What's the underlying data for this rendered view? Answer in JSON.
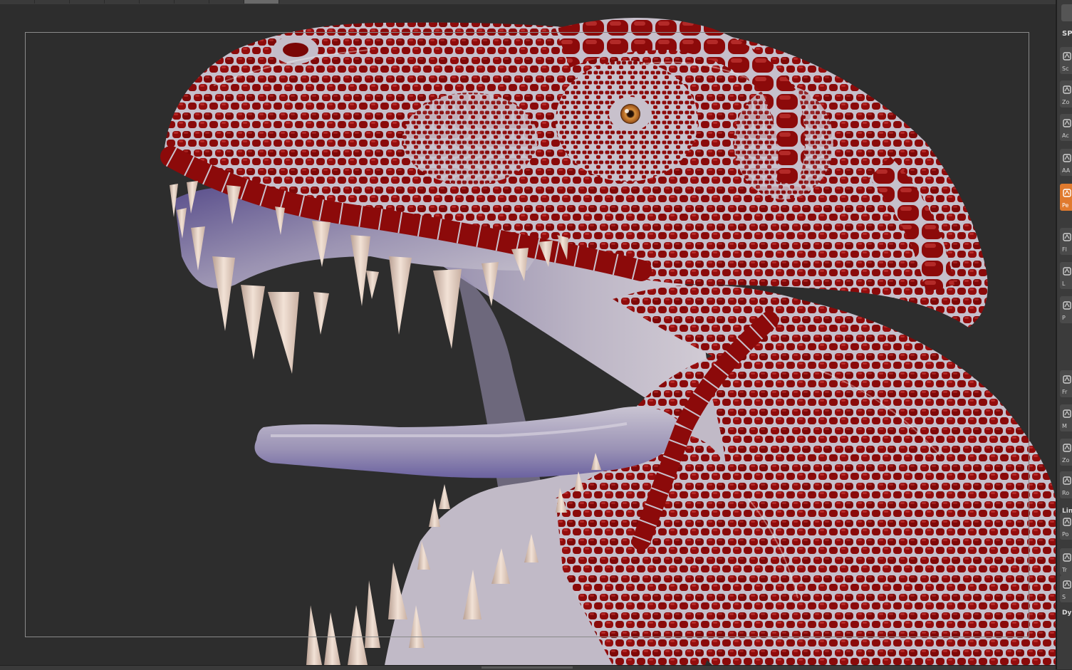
{
  "right_shelf": {
    "top_label": "SP",
    "group_label_1": "Lin",
    "group_label_2": "Dy",
    "buttons": [
      {
        "label": "Sc",
        "icon": "hand-icon"
      },
      {
        "label": "Zo",
        "icon": "magnifier-icon"
      },
      {
        "label": "Ac",
        "icon": "actual-size-icon"
      },
      {
        "label": "AA",
        "icon": "aahalf-icon"
      },
      {
        "label": "Pe",
        "icon": "persp-icon",
        "active": true
      },
      {
        "label": "Fl",
        "icon": "floor-icon"
      },
      {
        "label": "L",
        "icon": "local-icon"
      },
      {
        "label": "P",
        "icon": "lsym-icon"
      },
      {
        "label": "Fr",
        "icon": "frame-icon"
      },
      {
        "label": "M",
        "icon": "move-icon"
      },
      {
        "label": "Zo",
        "icon": "zoom3d-icon"
      },
      {
        "label": "Ro",
        "icon": "rotate-icon"
      },
      {
        "label": "Po",
        "icon": "polyframe-icon"
      },
      {
        "label": "Tr",
        "icon": "transp-icon"
      },
      {
        "label": "S",
        "icon": "solo-icon"
      }
    ]
  },
  "colors": {
    "canvas_bg": "#2d2d2d",
    "skin_red": "#8f0b0b",
    "skin_grey": "#a7a0ad",
    "teeth": "#e6d2c4",
    "accent": "#e07a2e"
  }
}
